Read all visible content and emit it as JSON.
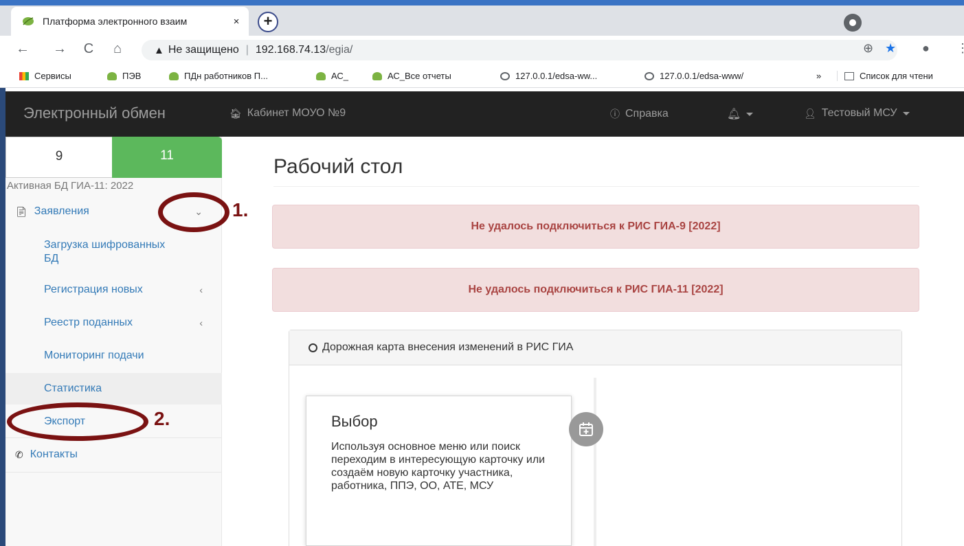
{
  "browser": {
    "tab_title": "Платформа электронного взаим",
    "close": "×",
    "new_tab": "+",
    "back": "←",
    "forward": "→",
    "reload": "C",
    "home": "⌂",
    "security_icon": "▲",
    "security_label": "Не защищено",
    "url_host": "192.168.74.13",
    "url_path": "/egia/",
    "zoom": "⊕",
    "star": "★",
    "profile": "●",
    "menu": "⋮",
    "bookmarks": [
      "Сервисы",
      "ПЭВ",
      "ПДн работников П...",
      "АС_",
      "АС_Все отчеты",
      "127.0.0.1/edsa-ww...",
      "127.0.0.1/edsa-www/"
    ],
    "more_bookmarks": "»",
    "reading_list": "Список для чтени"
  },
  "navbar": {
    "brand": "Электронный обмен",
    "cabinet": "Кабинет МОУО №9",
    "help": "Справка",
    "user": "Тестовый МСУ"
  },
  "sidebar": {
    "tab9": "9",
    "tab11": "11",
    "active_db": "Активная БД ГИА-11: 2022",
    "applications": "Заявления",
    "items": [
      "Загрузка шифрованных БД",
      "Регистрация новых",
      "Реестр поданных",
      "Мониторинг подачи",
      "Статистика",
      "Экспорт"
    ],
    "contacts": "Контакты"
  },
  "annotations": {
    "step1": "1.",
    "step2": "2."
  },
  "main": {
    "title": "Рабочий стол",
    "alert1": "Не удалось подключиться к РИС ГИА-9 [2022]",
    "alert2": "Не удалось подключиться к РИС ГИА-11 [2022]",
    "roadmap_title": "Дорожная карта внесения изменений в РИС ГИА",
    "card_title": "Выбор",
    "card_text": "Используя основное меню или поиск переходим в интересующую карточку или создаём новую карточку участника, работника, ППЭ, ОО, АТЕ, МСУ"
  },
  "colors": {
    "navbar_bg": "#222222",
    "success": "#5cb85c",
    "link": "#337ab7",
    "alert_bg": "#f2dede",
    "alert_text": "#a94442",
    "annotation": "#7a1212"
  }
}
